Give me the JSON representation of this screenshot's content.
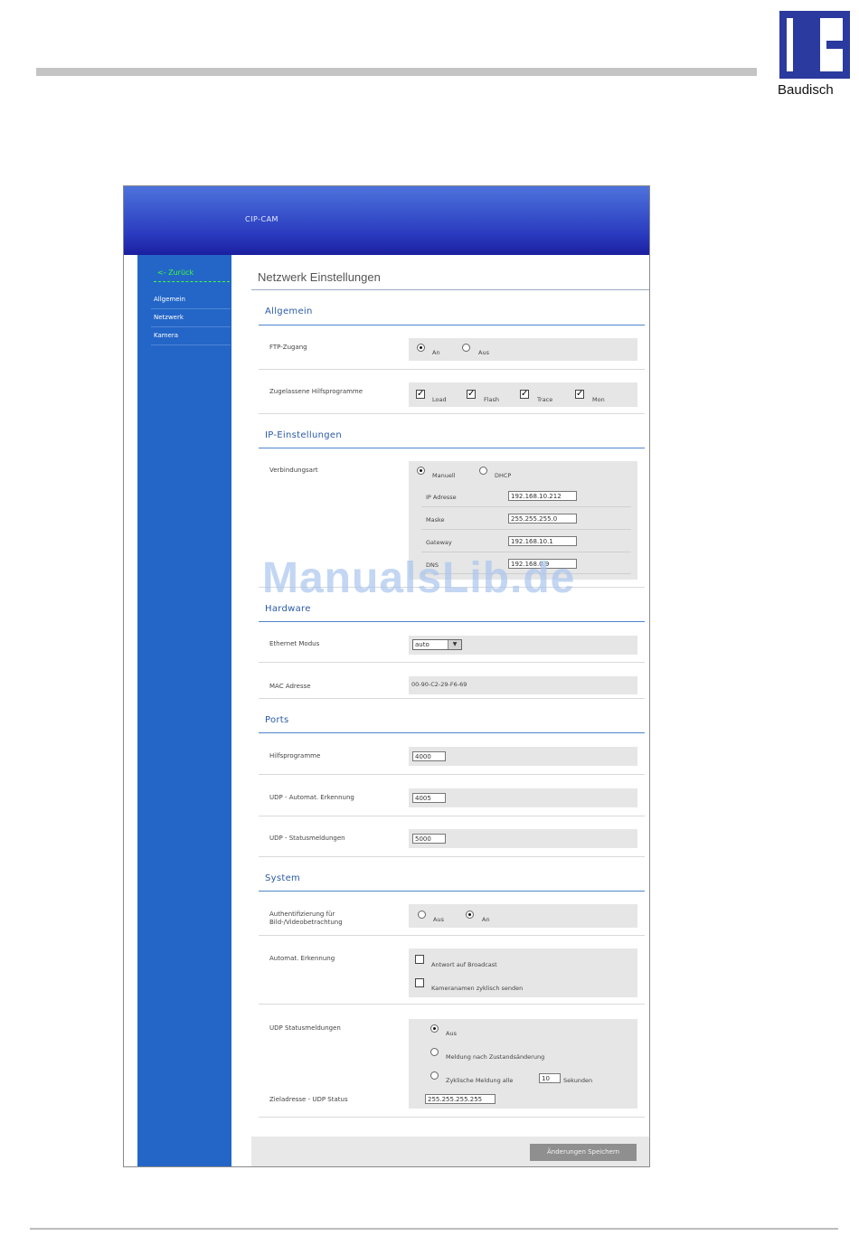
{
  "logo": {
    "brand": "Baudisch",
    "color": "#2b3a9e"
  },
  "app": {
    "title": "CIP-CAM"
  },
  "sidebar": {
    "back": "<- Zurück",
    "items": [
      {
        "label": "Allgemein"
      },
      {
        "label": "Netzwerk"
      },
      {
        "label": "Kamera"
      }
    ]
  },
  "page": {
    "heading": "Netzwerk Einstellungen"
  },
  "sections": {
    "allgemein": {
      "title": "Allgemein",
      "ftp": {
        "label": "FTP-Zugang",
        "options": [
          "An",
          "Aus"
        ],
        "selected": "An"
      },
      "helpers": {
        "label": "Zugelassene Hilfsprogramme",
        "options": [
          "Load",
          "Flash",
          "Trace",
          "Mon"
        ]
      }
    },
    "ip": {
      "title": "IP-Einstellungen",
      "mode": {
        "label": "Verbindungsart",
        "options": [
          "Manuell",
          "DHCP"
        ],
        "selected": "Manuell"
      },
      "fields": [
        {
          "label": "IP Adresse",
          "value": "192.168.10.212"
        },
        {
          "label": "Maske",
          "value": "255.255.255.0"
        },
        {
          "label": "Gateway",
          "value": "192.168.10.1"
        },
        {
          "label": "DNS",
          "value": "192.168.0.9"
        }
      ]
    },
    "hardware": {
      "title": "Hardware",
      "ethernet": {
        "label": "Ethernet Modus",
        "value": "auto"
      },
      "mac": {
        "label": "MAC Adresse",
        "value": "00-90-C2-29-F6-69"
      }
    },
    "ports": {
      "title": "Ports",
      "items": [
        {
          "label": "Hilfsprogramme",
          "value": "4000"
        },
        {
          "label": "UDP - Automat. Erkennung",
          "value": "4005"
        },
        {
          "label": "UDP - Statusmeldungen",
          "value": "5000"
        }
      ]
    },
    "system": {
      "title": "System",
      "auth": {
        "label_line1": "Authentifizierung für",
        "label_line2": "Bild-/Videobetrachtung",
        "options": [
          "Aus",
          "An"
        ],
        "selected": "An"
      },
      "autodetect": {
        "label": "Automat. Erkennung",
        "options": [
          "Antwort auf Broadcast",
          "Kameranamen zyklisch senden"
        ]
      },
      "udpstatus": {
        "label": "UDP Statusmeldungen",
        "options": [
          "Aus",
          "Meldung nach Zustandsänderung",
          "Zyklische Meldung alle"
        ],
        "selected": "Aus",
        "interval": "10",
        "unit": "Sekunden",
        "target_label": "Zieladresse - UDP Status",
        "target_value": "255.255.255.255"
      }
    }
  },
  "save_label": "Änderungen Speichern",
  "watermark": "ManualsLib.de"
}
